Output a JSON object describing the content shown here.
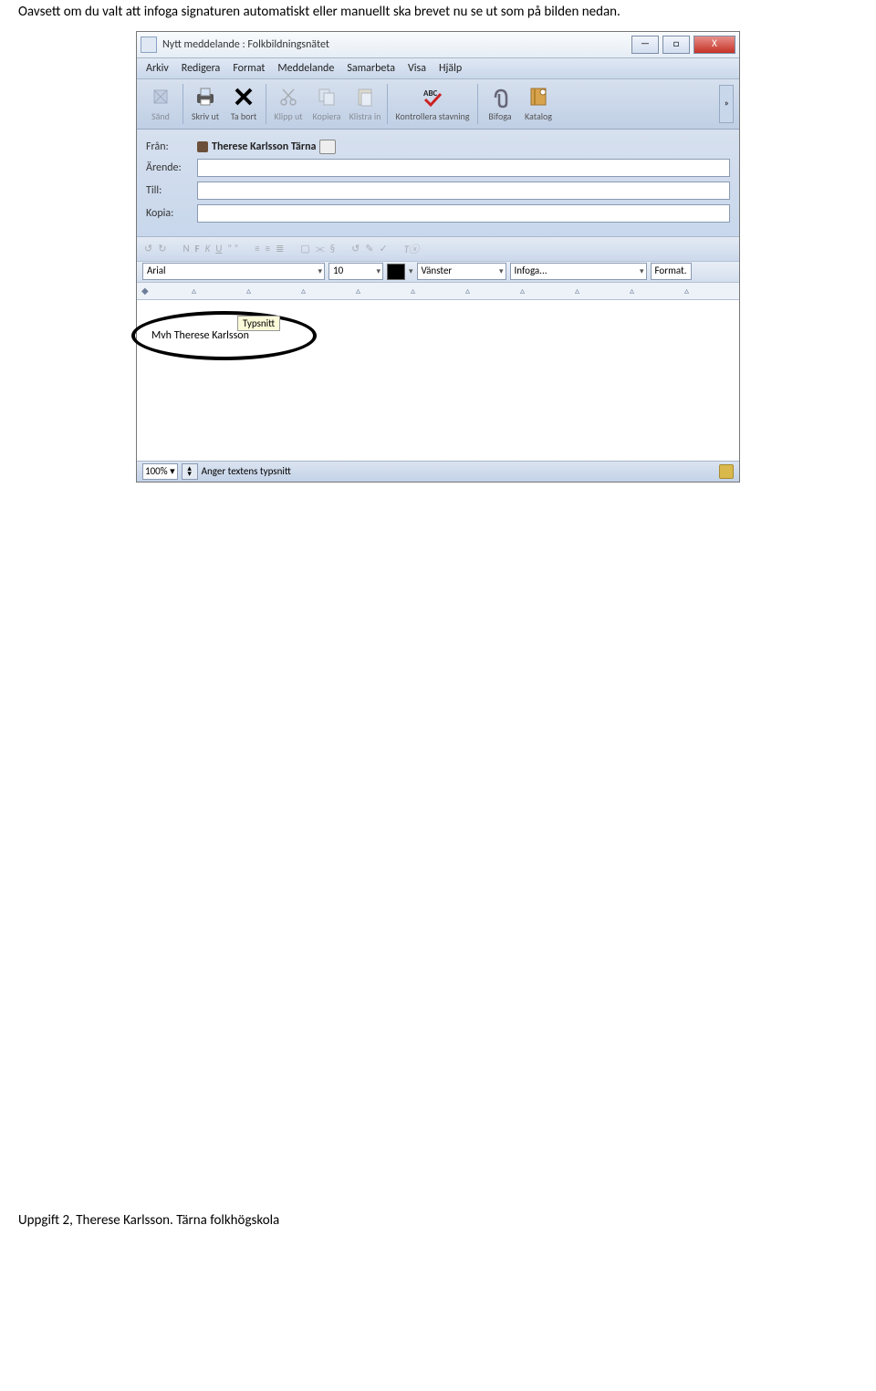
{
  "intro": "Oavsett om du valt att infoga signaturen automatiskt eller manuellt ska brevet nu se ut som på bilden nedan.",
  "window": {
    "title": "Nytt meddelande : Folkbildningsnätet",
    "min": "—",
    "max": "□",
    "close": "X"
  },
  "menu": {
    "arkiv": "Arkiv",
    "redigera": "Redigera",
    "format": "Format",
    "meddelande": "Meddelande",
    "samarbeta": "Samarbeta",
    "visa": "Visa",
    "hjalp": "Hjälp"
  },
  "toolbar": {
    "sand": "Sänd",
    "skrivut": "Skriv ut",
    "tabort": "Ta bort",
    "klippit": "Klipp ut",
    "kopiera": "Kopiera",
    "klistrain": "Klistra in",
    "kontrollera": "Kontrollera stavning",
    "bifoga": "Bifoga",
    "katalog": "Katalog"
  },
  "fields": {
    "fran_label": "Från:",
    "fran_value": "Therese Karlsson Tärna",
    "arende": "Ärende:",
    "till": "Till:",
    "kopia": "Kopia:"
  },
  "fontbar": {
    "font": "Arial",
    "size": "10",
    "align": "Vänster",
    "infoga": "Infoga...",
    "format": "Format."
  },
  "tooltip": "Typsnitt",
  "editor": {
    "signature": "Mvh Therese Karlsson"
  },
  "status": {
    "zoom": "100%",
    "text": "Anger textens typsnitt"
  },
  "footer": "Uppgift 2, Therese Karlsson. Tärna folkhögskola"
}
